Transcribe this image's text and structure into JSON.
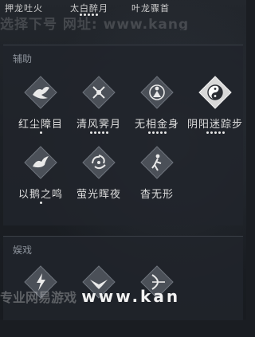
{
  "top_row": {
    "items": [
      {
        "label": "押龙吐火",
        "dots": 0
      },
      {
        "label": "太白醉月",
        "dots": 5
      },
      {
        "label": "叶龙骤首",
        "dots": 0
      }
    ]
  },
  "watermark_top": "选择下号  网址: www.kang",
  "sections": [
    {
      "title": "辅助",
      "items": [
        {
          "name": "红尘障目",
          "icon": "red-dust-veil-icon",
          "dots": 1
        },
        {
          "name": "清风霁月",
          "icon": "clear-wind-moon-icon",
          "dots": 5
        },
        {
          "name": "无相金身",
          "icon": "golden-body-icon",
          "dots": 5
        },
        {
          "name": "阴阳迷踪步",
          "icon": "yin-yang-icon",
          "dots": 5
        },
        {
          "name": "以鹅之鸣",
          "icon": "goose-call-icon",
          "dots": 1
        },
        {
          "name": "萤光晖夜",
          "icon": "firefly-swirl-icon",
          "dots": 0
        },
        {
          "name": "杳无形",
          "icon": "vanish-figure-icon",
          "dots": 0
        }
      ]
    },
    {
      "title": "娱戏",
      "items": [
        {
          "name": "",
          "icon": "lightning-figure-icon",
          "dots": 0
        },
        {
          "name": "",
          "icon": "bird-spread-icon",
          "dots": 0
        },
        {
          "name": "",
          "icon": "archer-icon",
          "dots": 0
        }
      ]
    }
  ],
  "watermark_bottom": {
    "cn": "专业网易游戏",
    "url": "www.kan"
  },
  "colors": {
    "background": "#1a1d22",
    "panel": "#21252b",
    "diamond_fill": "#4b5058",
    "diamond_selected": "#d8d8d8",
    "text": "#dedede"
  }
}
